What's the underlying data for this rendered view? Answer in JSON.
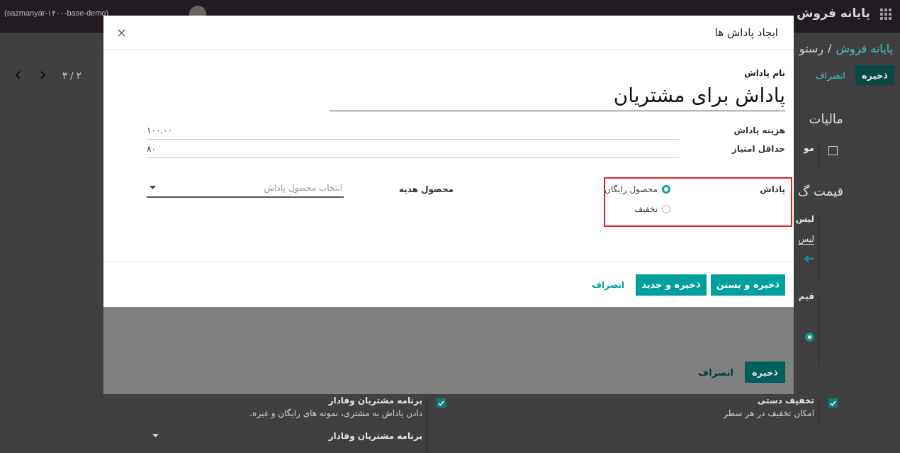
{
  "navbar": {
    "app_title": "پایانه فروش",
    "database": "(sazmanyar-۱۴۰۰-base-demo)"
  },
  "control_panel": {
    "breadcrumb_parent": "پایانه فروش",
    "breadcrumb_separator": "/",
    "breadcrumb_current": "رستو",
    "save": "ذخیره",
    "discard": "انصراف",
    "pager": "۲ / ۳"
  },
  "settings": {
    "taxes_heading": "مالیات",
    "tax_setting": {
      "label": "مو",
      "checked": false
    },
    "pricing_heading": "قیمت گ",
    "pricelist_setting": {
      "label": "لیس",
      "value": "لیس"
    },
    "price_control": {
      "label": "قیم",
      "selected": true
    },
    "manual_discount": {
      "title": "تخفیف دستی",
      "description": "امکان تخفیف در هر سطر",
      "checked": true
    },
    "loyalty": {
      "title": "برنامه مشتریان وفادار",
      "description": "دادن پاداش به مشتری، نمونه های رایگان و غیره.",
      "field_label": "برنامه مشتریان وفادار",
      "checked": true
    }
  },
  "parent_dialog": {
    "buttons": [
      {
        "label": "ذخیره",
        "kind": "primary"
      },
      {
        "label": "انصراف",
        "kind": "link"
      }
    ]
  },
  "dialog": {
    "title": "ایجاد پاداش ها",
    "close": "×",
    "name_label": "نام پاداش",
    "name_value": "پاداش برای مشتریان",
    "fields": [
      {
        "label": "هزینه پاداش",
        "value": "۱۰۰.۰۰"
      },
      {
        "label": "حداقل امتیاز",
        "value": "۸۰"
      }
    ],
    "reward_type": {
      "label": "پاداش",
      "options": [
        {
          "label": "محصول رایگان",
          "selected": true
        },
        {
          "label": "تخفیف",
          "selected": false
        }
      ]
    },
    "gift_product": {
      "label": "محصول هدیه",
      "placeholder": "انتخاب محصول پاداش"
    },
    "buttons": [
      {
        "label": "ذخیره و بستن",
        "kind": "primary"
      },
      {
        "label": "ذخیره و جدید",
        "kind": "primary"
      },
      {
        "label": "انصراف",
        "kind": "link"
      }
    ]
  }
}
